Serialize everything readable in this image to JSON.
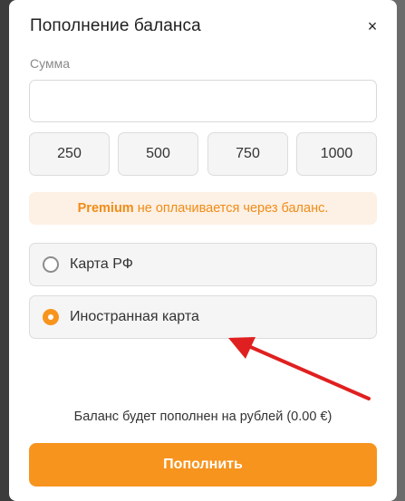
{
  "modal": {
    "title": "Пополнение баланса",
    "close_icon": "×"
  },
  "amount": {
    "label": "Сумма",
    "value": "",
    "placeholder": ""
  },
  "presets": [
    "250",
    "500",
    "750",
    "1000"
  ],
  "notice": {
    "bold": "Premium",
    "rest": " не оплачивается через баланс."
  },
  "payment_options": [
    {
      "label": "Карта РФ",
      "selected": false
    },
    {
      "label": "Иностранная карта",
      "selected": true
    }
  ],
  "balance_note": "Баланс будет пополнен на рублей (0.00 €)",
  "submit_label": "Пополнить",
  "colors": {
    "accent": "#f7941d",
    "notice_bg": "#fdf0e4",
    "annotation_arrow": "#e02020"
  },
  "annotation": {
    "icon": "red-arrow-icon"
  }
}
